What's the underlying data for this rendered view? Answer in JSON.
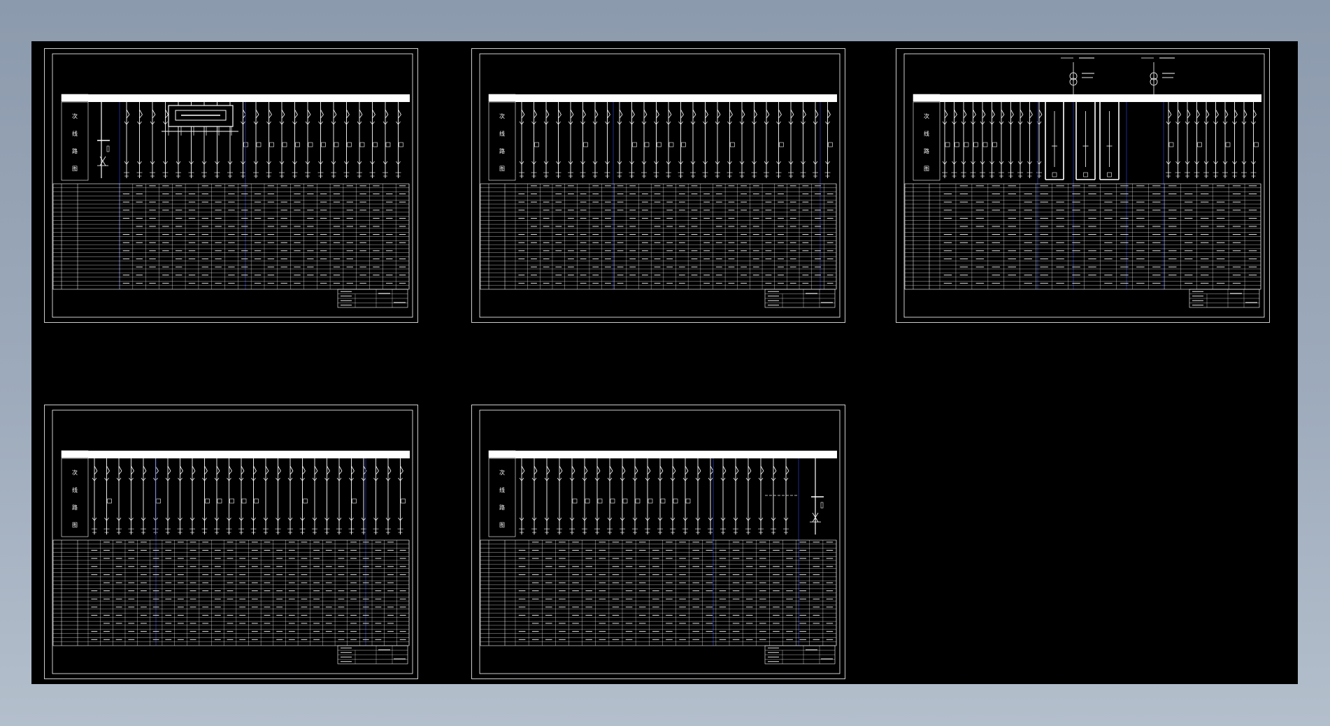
{
  "window": {
    "background_top": "#8c9aad",
    "background_bottom": "#b4bfcc",
    "canvas_color": "#000000"
  },
  "colors": {
    "line": "#ffffff",
    "divider": "#1f2a8a"
  },
  "sheets": [
    {
      "id": "sheet-1",
      "row_label_chars": [
        "次",
        "线",
        "路",
        "图"
      ],
      "feeder_count": 22,
      "variant": "incomer-left-with-bus-box"
    },
    {
      "id": "sheet-2",
      "row_label_chars": [
        "次",
        "线",
        "路",
        "图"
      ],
      "feeder_count": 26,
      "variant": "feeders-only"
    },
    {
      "id": "sheet-3",
      "row_label_chars": [
        "次",
        "线",
        "路",
        "图"
      ],
      "feeder_count": 20,
      "variant": "transformers-top"
    },
    {
      "id": "sheet-4",
      "row_label_chars": [
        "次",
        "线",
        "路",
        "图"
      ],
      "feeder_count": 26,
      "variant": "feeders-only"
    },
    {
      "id": "sheet-5",
      "row_label_chars": [
        "次",
        "线",
        "路",
        "图"
      ],
      "feeder_count": 24,
      "variant": "incomer-right"
    }
  ]
}
